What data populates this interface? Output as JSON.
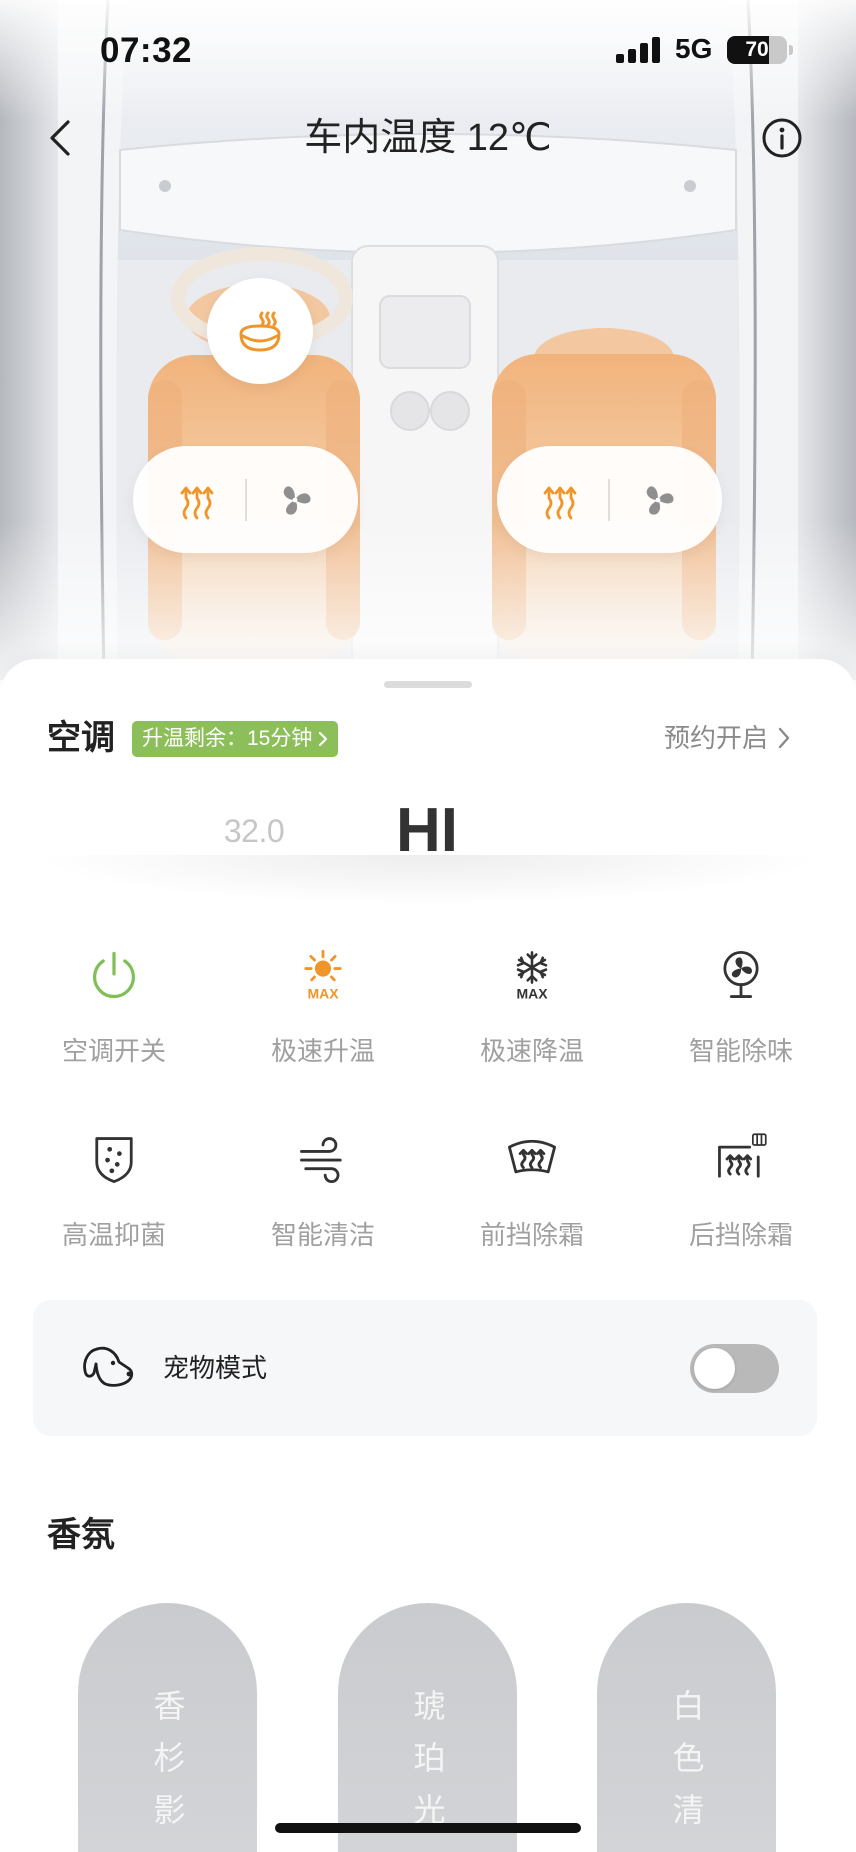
{
  "status_bar": {
    "time": "07:32",
    "network": "5G",
    "battery": "70"
  },
  "header": {
    "title": "车内温度 12℃",
    "back_icon": "chevron-left-icon",
    "info_icon": "info-icon"
  },
  "cabin": {
    "steering_wheel_heat": {
      "icon": "steering-wheel-heat-icon",
      "active": true
    },
    "seats": [
      {
        "heat_icon": "seat-heat-icon",
        "heat_active": true,
        "vent_icon": "seat-fan-icon",
        "vent_active": false
      },
      {
        "heat_icon": "seat-heat-icon",
        "heat_active": true,
        "vent_icon": "seat-fan-icon",
        "vent_active": false
      }
    ]
  },
  "climate": {
    "title": "空调",
    "badge": "升温剩余：15分钟",
    "schedule": "预约开启",
    "temperature": {
      "previous": "32.0",
      "current": "HI"
    }
  },
  "functions": [
    {
      "label": "空调开关",
      "icon": "power-icon",
      "color": "#7fbf56"
    },
    {
      "label": "极速升温",
      "icon": "max-heat-icon",
      "icon_text": "MAX",
      "color": "#f0952a"
    },
    {
      "label": "极速降温",
      "icon": "max-cool-icon",
      "icon_text": "MAX",
      "color": "#333333"
    },
    {
      "label": "智能除味",
      "icon": "deodorize-fan-icon",
      "color": "#333333"
    },
    {
      "label": "高温抑菌",
      "icon": "sterilize-shield-icon",
      "color": "#333333"
    },
    {
      "label": "智能清洁",
      "icon": "clean-wind-icon",
      "color": "#333333"
    },
    {
      "label": "前挡除霜",
      "icon": "front-defrost-icon",
      "color": "#333333"
    },
    {
      "label": "后挡除霜",
      "icon": "rear-defrost-icon",
      "color": "#333333"
    }
  ],
  "pet_mode": {
    "label": "宠物模式",
    "icon": "dog-icon",
    "enabled": false
  },
  "fragrance": {
    "title": "香氛",
    "items": [
      {
        "name": "香杉影"
      },
      {
        "name": "琥珀光"
      },
      {
        "name": "白色清"
      }
    ]
  },
  "colors": {
    "accent_orange": "#f0952a",
    "accent_green": "#7fbf56",
    "badge_green": "#8cbf5a",
    "text_primary": "#222222",
    "text_secondary": "#9a9a9a"
  }
}
